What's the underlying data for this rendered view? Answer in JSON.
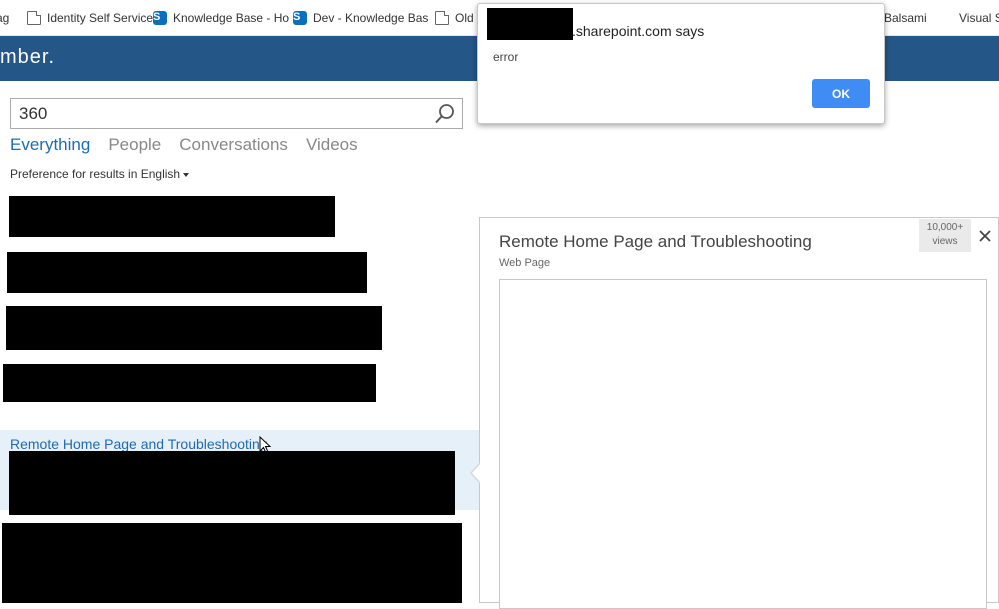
{
  "bookmarks": [
    {
      "label": "ag",
      "icon": "page-icon"
    },
    {
      "label": "Identity Self Service",
      "icon": "page-icon"
    },
    {
      "label": "Knowledge Base - Ho",
      "icon": "sharepoint-icon"
    },
    {
      "label": "Dev - Knowledge Bas",
      "icon": "sharepoint-icon"
    },
    {
      "label": "Old I",
      "icon": "page-icon"
    },
    {
      "label": "Balsami",
      "icon": "page-icon"
    },
    {
      "label": "Visual St",
      "icon": "microsoft-icon"
    }
  ],
  "header": {
    "brand": "mber."
  },
  "search": {
    "value": "360",
    "icon": "search-icon"
  },
  "tabs": [
    {
      "label": "Everything",
      "active": true
    },
    {
      "label": "People",
      "active": false
    },
    {
      "label": "Conversations",
      "active": false
    },
    {
      "label": "Videos",
      "active": false
    }
  ],
  "preference": {
    "label": "Preference for results in",
    "language": "English"
  },
  "result": {
    "title": "Remote Home Page and Troubleshooting"
  },
  "preview": {
    "title": "Remote Home Page and Troubleshooting",
    "type": "Web Page",
    "views_count": "10,000+",
    "views_label": "views",
    "close_icon": "close-icon"
  },
  "dialog": {
    "title_suffix": ".sharepoint.com says",
    "message": "error",
    "ok_label": "OK"
  },
  "colors": {
    "header_bg": "#245687",
    "link": "#1f6bb2",
    "ok_button": "#3f8cf4",
    "selected_row": "#e6f0f8"
  }
}
